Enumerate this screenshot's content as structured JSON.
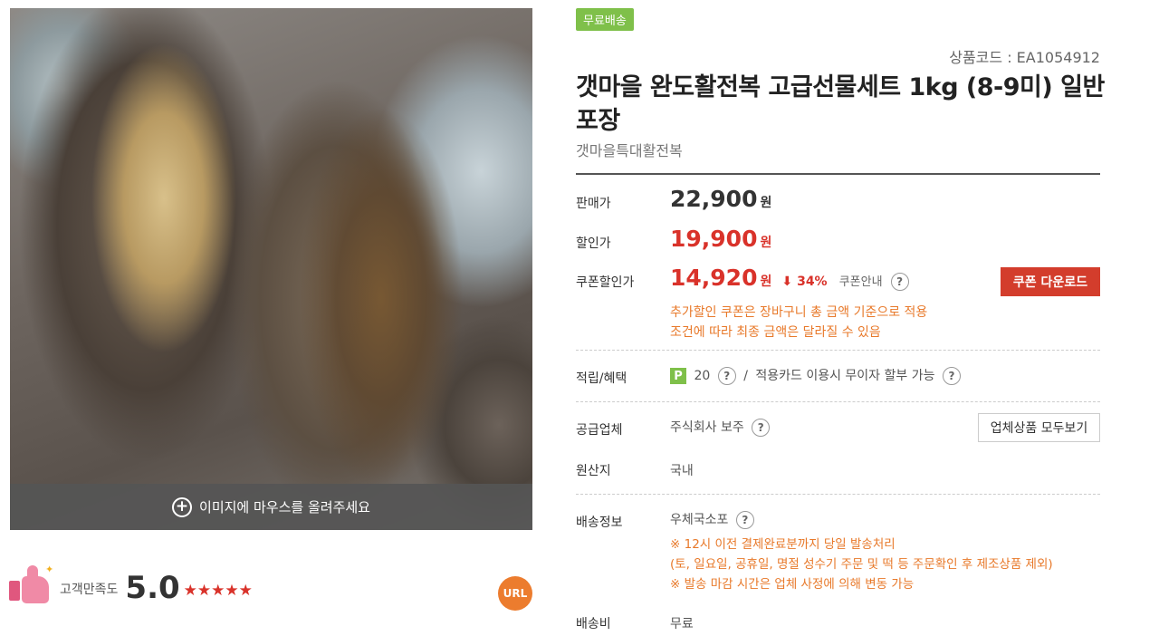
{
  "image_panel": {
    "hover_hint": "이미지에 마우스를 올려주세요"
  },
  "satisfaction": {
    "label": "고객만족도",
    "score": "5.0",
    "stars": "★★★★★",
    "rating_out_of_5": 5
  },
  "url_button": "URL",
  "badge": "무료배송",
  "product": {
    "code": "상품코드 : EA1054912",
    "title": "갯마을 완도활전복 고급선물세트 1kg (8-9미) 일반 포장",
    "seller": "갯마을특대활전복"
  },
  "pricing": {
    "sale_label": "판매가",
    "sale_price": "22,900",
    "discount_label": "할인가",
    "discount_price": "19,900",
    "coupon_label": "쿠폰할인가",
    "coupon_price": "14,920",
    "won": "원",
    "discount_rate": "⬇ 34%",
    "coupon_info": "쿠폰안내",
    "coupon_download": "쿠폰 다운로드",
    "notes": [
      "추가할인 쿠폰은 장바구니 총 금액 기준으로 적용",
      "조건에 따라 최종 금액은 달라질 수 있음"
    ]
  },
  "benefits": {
    "label": "적립/혜택",
    "points_icon": "P",
    "points": "20",
    "separator": "/",
    "card_text": "적용카드 이용시 무이자 할부 가능"
  },
  "supplier": {
    "label": "공급업체",
    "value": "주식회사 보주",
    "view_all": "업체상품 모두보기"
  },
  "origin": {
    "label": "원산지",
    "value": "국내"
  },
  "shipping": {
    "label": "배송정보",
    "value": "우체국소포",
    "notes": [
      "※ 12시 이전 결제완료분까지 당일 발송처리",
      "(토, 일요일, 공휴일, 명절 성수기 주문 및 떡 등 주문확인 후 제조상품 제외)",
      "※ 발송 마감 시간은 업체 사정에 의해 변동 가능"
    ]
  },
  "shipping_fee": {
    "label": "배송비",
    "value": "무료"
  },
  "help_mark": "?",
  "colors": {
    "accent_red": "#d9322a",
    "badge_green": "#7fc04a",
    "note_orange": "#e8792a"
  }
}
